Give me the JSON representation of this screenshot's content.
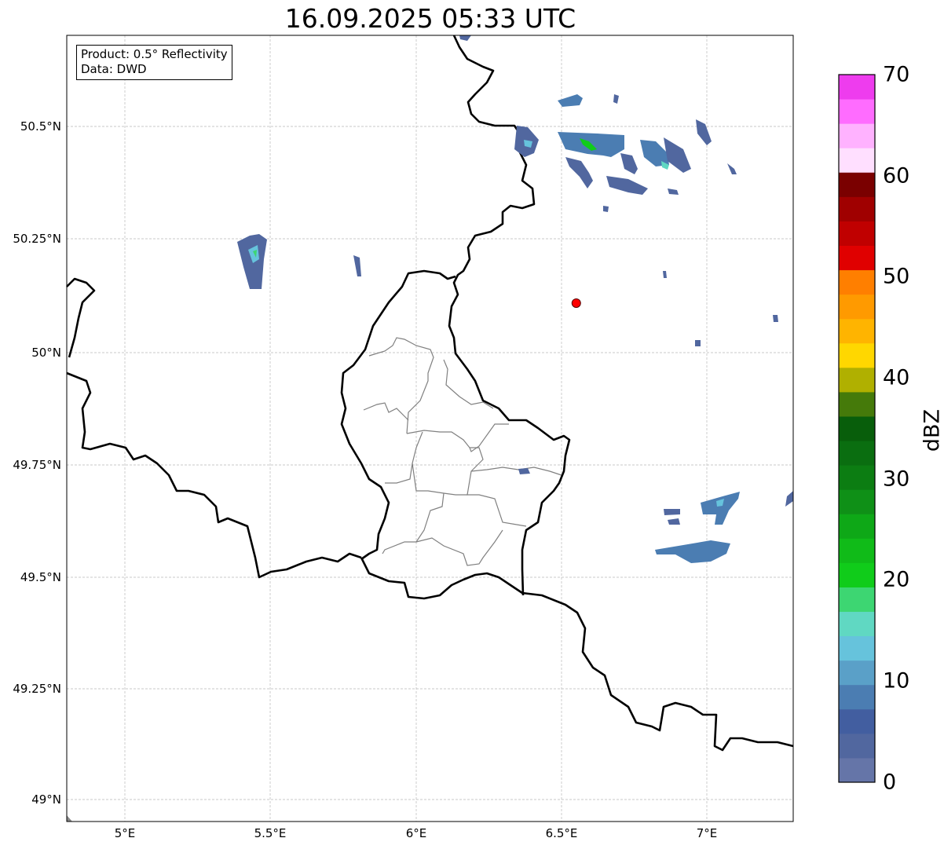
{
  "title": "16.09.2025 05:33 UTC",
  "info_box": {
    "product": "Product: 0.5° Reflectivity",
    "data_source": "Data: DWD"
  },
  "map": {
    "extent_lon": [
      4.8,
      7.3
    ],
    "extent_lat": [
      48.95,
      50.7
    ],
    "lon_ticks": [
      "5°E",
      "5.5°E",
      "6°E",
      "6.5°E",
      "7°E"
    ],
    "lat_ticks": [
      "50.5°N",
      "50.25°N",
      "50°N",
      "49.75°N",
      "49.5°N",
      "49.25°N",
      "49°N"
    ],
    "marker": {
      "lon": 6.55,
      "lat": 50.11,
      "color": "#ff0000"
    }
  },
  "colorbar": {
    "label": "dBZ",
    "ticks": [
      "0",
      "10",
      "20",
      "30",
      "40",
      "50",
      "60",
      "70"
    ],
    "range": [
      0,
      70
    ],
    "colors": [
      "#6575a8",
      "#51679f",
      "#425ea0",
      "#4b7db2",
      "#5aa0c8",
      "#66c3dc",
      "#60d8c2",
      "#3dd672",
      "#10cc1a",
      "#10bb18",
      "#0ea817",
      "#0f9017",
      "#0c7d12",
      "#0a6e10",
      "#085e0b",
      "#457a0a",
      "#b0b000",
      "#ffd700",
      "#ffb400",
      "#ff9a00",
      "#ff7f00",
      "#e00000",
      "#c00000",
      "#a00000",
      "#7a0000",
      "#ffdfff",
      "#ffb2ff",
      "#ff6cff",
      "#ee3cee"
    ]
  }
}
